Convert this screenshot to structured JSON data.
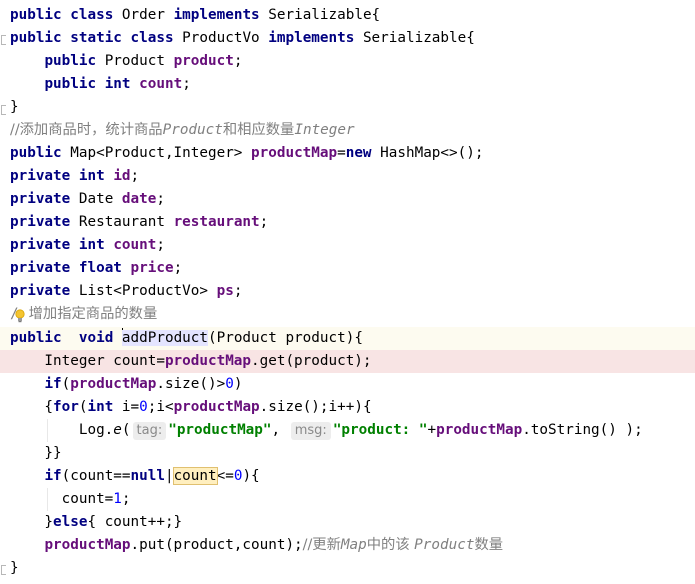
{
  "editor": {
    "lines": {
      "l1": {
        "a": "public",
        "b": " ",
        "c": "class",
        "d": " Order ",
        "e": "implements",
        "f": " Serializable{"
      },
      "l2": {
        "a": "public",
        "b": " ",
        "c": "static",
        "d": " ",
        "e": "class",
        "f": " ProductVo ",
        "g": "implements",
        "h": " Serializable{"
      },
      "l3": {
        "a": "    ",
        "b": "public",
        "c": " Product ",
        "d": "product",
        "e": ";"
      },
      "l4": {
        "a": "    ",
        "b": "public",
        "c": " ",
        "d": "int",
        "e": " ",
        "f": "count",
        "g": ";"
      },
      "l5": {
        "a": "}"
      },
      "l6": {
        "a": "//添加商品时，统计商品",
        "b": "Product",
        "c": "和相应数量",
        "d": "Integer"
      },
      "l7": {
        "a": "public",
        "b": " Map<Product,Integer> ",
        "c": "productMap",
        "d": "=",
        "e": "new",
        "f": " HashMap<>();"
      },
      "l8": {
        "a": "private",
        "b": " ",
        "c": "int",
        "d": " ",
        "e": "id",
        "f": ";"
      },
      "l9": {
        "a": "private",
        "b": " Date ",
        "c": "date",
        "d": ";"
      },
      "l10": {
        "a": "private",
        "b": " Restaurant ",
        "c": "restaurant",
        "d": ";"
      },
      "l11": {
        "a": "private",
        "b": " ",
        "c": "int",
        "d": " ",
        "e": "count",
        "f": ";"
      },
      "l12": {
        "a": "private",
        "b": " ",
        "c": "float",
        "d": " ",
        "e": "price",
        "f": ";"
      },
      "l13": {
        "a": "private",
        "b": " List<ProductVo> ",
        "c": "ps",
        "d": ";"
      },
      "l14": {
        "a": "/",
        "b": "增加指定商品的数量"
      },
      "l15": {
        "a": "public",
        "b": "  ",
        "c": "void",
        "d": " ",
        "e": "addProduct",
        "f": "(Product product){"
      },
      "l16": {
        "a": "    Integer count=",
        "b": "productMap",
        "c": ".get(product);"
      },
      "l17": {
        "a": "    ",
        "b": "if",
        "c": "(",
        "d": "productMap",
        "e": ".size()>",
        "f": "0",
        "g": ")"
      },
      "l18": {
        "a": "    {",
        "b": "for",
        "c": "(",
        "d": "int",
        "e": " i=",
        "f": "0",
        "g": ";i<",
        "h": "productMap",
        "i": ".size();i++){"
      },
      "l19": {
        "a": "        Log.",
        "b": "e",
        "c": "(",
        "d": "tag:",
        "e": "\"productMap\"",
        "f": ", ",
        "g": "msg:",
        "h": "\"product: \"",
        "i": "+",
        "j": "productMap",
        "k": ".toString() );"
      },
      "l20": {
        "a": "    }}"
      },
      "l21": {
        "a": "    ",
        "b": "if",
        "c": "(count==",
        "d": "null",
        "e": "|",
        "f": "count",
        "g": "<=",
        "h": "0",
        "i": "){"
      },
      "l22": {
        "a": "      count=",
        "b": "1",
        "c": ";"
      },
      "l23": {
        "a": "    }",
        "b": "else",
        "c": "{ count++;}"
      },
      "l24": {
        "a": "    ",
        "b": "productMap",
        "c": ".put(product,count);",
        "d": "//更新",
        "e": "Map",
        "f": "中的该 ",
        "g": "Product",
        "h": "数量"
      },
      "l25": {
        "a": "}"
      }
    }
  },
  "colors": {
    "keyword": "#000080",
    "field": "#660e7a",
    "number": "#0000ff",
    "string": "#008000",
    "comment": "#808080",
    "caret_line": "#fdfbf0",
    "error_line": "#f8e4e4"
  },
  "icons": {
    "intention": "lightbulb-icon"
  }
}
